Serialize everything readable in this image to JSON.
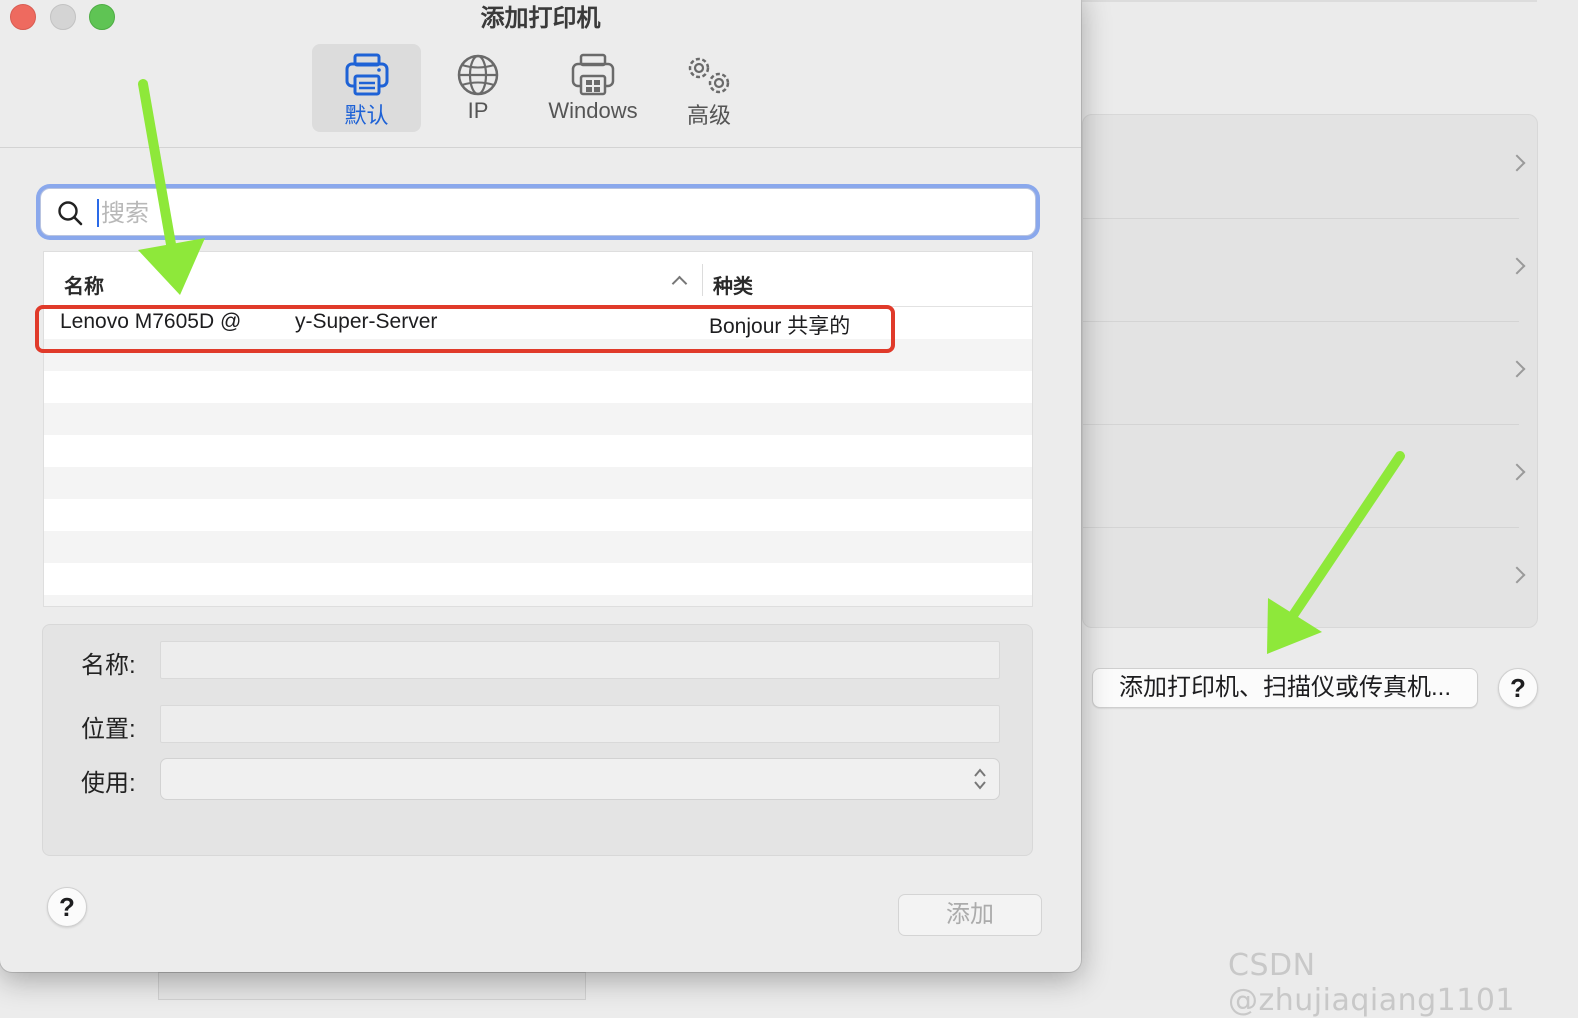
{
  "dialog": {
    "title": "添加打印机",
    "toolbar": [
      {
        "label": "默认",
        "icon": "printer-icon",
        "active": true
      },
      {
        "label": "IP",
        "icon": "globe-icon",
        "active": false
      },
      {
        "label": "Windows",
        "icon": "windows-printer-icon",
        "active": false
      },
      {
        "label": "高级",
        "icon": "gears-icon",
        "active": false
      }
    ],
    "search": {
      "placeholder": "搜索",
      "value": ""
    },
    "table": {
      "columns": {
        "name": "名称",
        "kind": "种类"
      },
      "rows": [
        {
          "name": "Lenovo M7605D @",
          "name_suffix": "y-Super-Server",
          "kind": "Bonjour 共享的",
          "selected": true
        }
      ]
    },
    "form": {
      "name_label": "名称:",
      "location_label": "位置:",
      "use_label": "使用:",
      "name_value": "",
      "location_value": "",
      "use_value": ""
    },
    "help_label": "?",
    "add_label": "添加"
  },
  "background": {
    "add_button_label": "添加打印机、扫描仪或传真机...",
    "help_label": "?"
  },
  "watermark": "CSDN @zhujiaqiang1101",
  "colors": {
    "accent": "#1e62d6",
    "annotation_red": "#e03a2a",
    "annotation_green": "#8ee83a",
    "search_focus": "#8aa8ec"
  }
}
